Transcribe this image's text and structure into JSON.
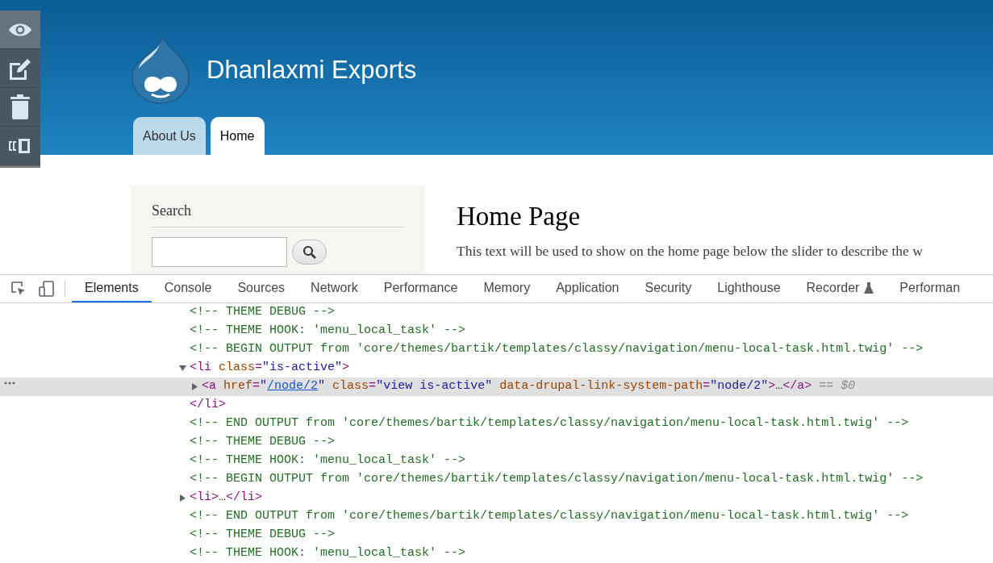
{
  "toolbar": [
    {
      "selected": true
    },
    {
      "selected": false
    },
    {
      "selected": false
    },
    {
      "selected": false
    }
  ],
  "site": {
    "name": "Dhanlaxmi Exports",
    "tabs": [
      {
        "label": "About Us",
        "selected": false
      },
      {
        "label": "Home",
        "selected": true
      }
    ]
  },
  "sidebar": {
    "title": "Search"
  },
  "main": {
    "title": "Home Page",
    "text": "This text will be used to show on the home page below the slider to describe the w"
  },
  "devtools": {
    "tabs": [
      {
        "label": "Elements",
        "selected": true,
        "experimental": false
      },
      {
        "label": "Console",
        "selected": false,
        "experimental": false
      },
      {
        "label": "Sources",
        "selected": false,
        "experimental": false
      },
      {
        "label": "Network",
        "selected": false,
        "experimental": false
      },
      {
        "label": "Performance",
        "selected": false,
        "experimental": false
      },
      {
        "label": "Memory",
        "selected": false,
        "experimental": false
      },
      {
        "label": "Application",
        "selected": false,
        "experimental": false
      },
      {
        "label": "Security",
        "selected": false,
        "experimental": false
      },
      {
        "label": "Lighthouse",
        "selected": false,
        "experimental": false
      },
      {
        "label": "Recorder",
        "selected": false,
        "experimental": true
      },
      {
        "label": "Performan",
        "selected": false,
        "experimental": false
      }
    ],
    "nodes": [
      {
        "selected": false,
        "tokens": [
          {
            "kind": "comment",
            "text": "<!-- THEME DEBUG -->"
          }
        ]
      },
      {
        "selected": false,
        "tokens": [
          {
            "kind": "comment",
            "text": "<!-- THEME HOOK: 'menu_local_task' -->"
          }
        ]
      },
      {
        "selected": false,
        "tokens": [
          {
            "kind": "comment",
            "text": "<!-- BEGIN OUTPUT from 'core/themes/bartik/templates/classy/navigation/menu-local-task.html.twig' -->"
          }
        ]
      },
      {
        "selected": false,
        "expanded": true,
        "tokens": [
          {
            "kind": "tag",
            "text": "<li "
          },
          {
            "kind": "attr",
            "text": "class"
          },
          {
            "kind": "tag",
            "text": "="
          },
          {
            "kind": "value",
            "text": "\"is-active\""
          },
          {
            "kind": "tag",
            "text": ">"
          }
        ],
        "children": [
          {
            "selected": true,
            "expanded": false,
            "tokens": [
              {
                "kind": "tag",
                "text": "<a "
              },
              {
                "kind": "attr",
                "text": "href"
              },
              {
                "kind": "tag",
                "text": "="
              },
              {
                "kind": "value",
                "text": "\""
              },
              {
                "kind": "link",
                "text": "/node/2"
              },
              {
                "kind": "value",
                "text": "\""
              },
              {
                "kind": "attr",
                "text": " class"
              },
              {
                "kind": "tag",
                "text": "="
              },
              {
                "kind": "value",
                "text": "\"view is-active\""
              },
              {
                "kind": "attr",
                "text": " data-drupal-link-system-path"
              },
              {
                "kind": "tag",
                "text": "="
              },
              {
                "kind": "value",
                "text": "\"node/2\""
              },
              {
                "kind": "tag",
                "text": ">"
              },
              {
                "kind": "plain",
                "text": "…"
              },
              {
                "kind": "tag",
                "text": "</a>"
              },
              {
                "kind": "dim",
                "text": " == $0"
              }
            ]
          }
        ],
        "close": [
          {
            "kind": "tag",
            "text": "</li>"
          }
        ]
      },
      {
        "selected": false,
        "tokens": [
          {
            "kind": "comment",
            "text": "<!-- END OUTPUT from 'core/themes/bartik/templates/classy/navigation/menu-local-task.html.twig' -->"
          }
        ]
      },
      {
        "selected": false,
        "tokens": [
          {
            "kind": "comment",
            "text": "<!-- THEME DEBUG -->"
          }
        ]
      },
      {
        "selected": false,
        "tokens": [
          {
            "kind": "comment",
            "text": "<!-- THEME HOOK: 'menu_local_task' -->"
          }
        ]
      },
      {
        "selected": false,
        "tokens": [
          {
            "kind": "comment",
            "text": "<!-- BEGIN OUTPUT from 'core/themes/bartik/templates/classy/navigation/menu-local-task.html.twig' -->"
          }
        ]
      },
      {
        "selected": false,
        "expanded": false,
        "tokens": [
          {
            "kind": "tag",
            "text": "<li>"
          },
          {
            "kind": "plain",
            "text": "…"
          },
          {
            "kind": "tag",
            "text": "</li>"
          }
        ]
      },
      {
        "selected": false,
        "tokens": [
          {
            "kind": "comment",
            "text": "<!-- END OUTPUT from 'core/themes/bartik/templates/classy/navigation/menu-local-task.html.twig' -->"
          }
        ]
      },
      {
        "selected": false,
        "tokens": [
          {
            "kind": "comment",
            "text": "<!-- THEME DEBUG -->"
          }
        ]
      },
      {
        "selected": false,
        "tokens": [
          {
            "kind": "comment",
            "text": "<!-- THEME HOOK: 'menu_local_task' -->"
          }
        ]
      }
    ]
  }
}
